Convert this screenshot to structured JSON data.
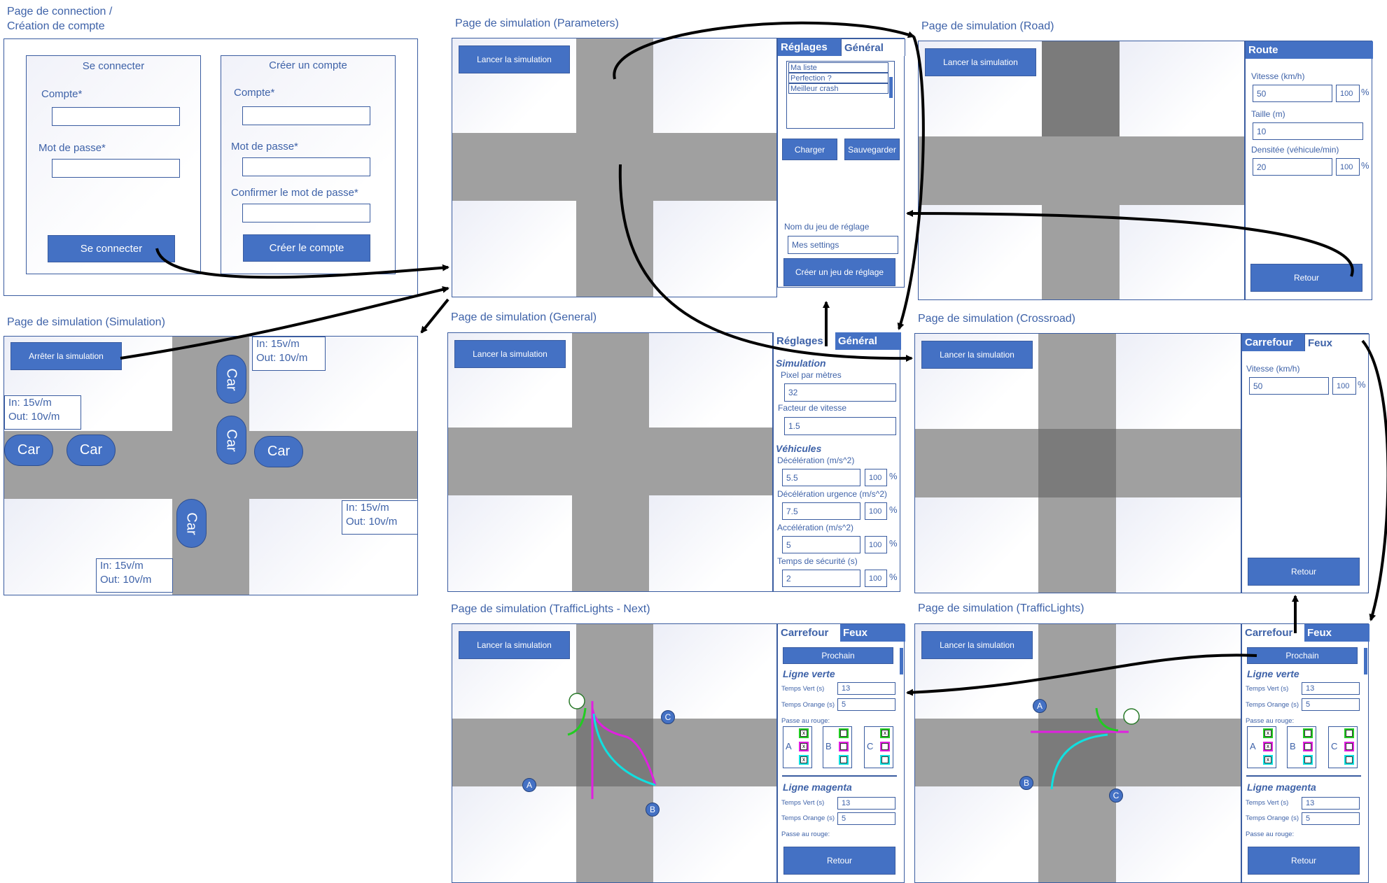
{
  "login": {
    "title_line1": "Page de connection /",
    "title_line2": "Création de compte",
    "connect_title": "Se connecter",
    "account_label": "Compte*",
    "password_label": "Mot de passe*",
    "connect_button": "Se connecter",
    "create_title": "Créer un compte",
    "create_account_label": "Compte*",
    "create_password_label": "Mot de passe*",
    "confirm_label": "Confirmer le mot de passe*",
    "create_button": "Créer le compte"
  },
  "parameters": {
    "title": "Page de simulation (Parameters)",
    "launch_button": "Lancer la simulation",
    "tab_reglages": "Réglages",
    "tab_general": "Général",
    "list_items": [
      "Ma liste",
      "Perfection ?",
      "Meilleur crash"
    ],
    "load_button": "Charger",
    "save_button": "Sauvegarder",
    "settings_name_label": "Nom du jeu de réglage",
    "settings_name_value": "Mes settings",
    "create_settings_button": "Créer un jeu de réglage"
  },
  "road": {
    "title": "Page de simulation (Road)",
    "launch_button": "Lancer la simulation",
    "header": "Route",
    "speed_label": "Vitesse (km/h)",
    "speed_value": "50",
    "speed_pct": "100",
    "size_label": "Taille (m)",
    "size_value": "10",
    "density_label": "Densitée (véhicule/min)",
    "density_value": "20",
    "density_pct": "100",
    "pct_sign": "%",
    "back_button": "Retour"
  },
  "simulation": {
    "title": "Page de simulation (Simulation)",
    "stop_button": "Arrêter la simulation",
    "car_label": "Car",
    "in_label": "In: 15v/m",
    "out_label": "Out: 10v/m"
  },
  "general": {
    "title": "Page de simulation (General)",
    "launch_button": "Lancer la simulation",
    "tab_reglages": "Réglages",
    "tab_general": "Général",
    "section_simulation": "Simulation",
    "pixel_label": "Pixel par mètres",
    "pixel_value": "32",
    "speed_factor_label": "Facteur de vitesse",
    "speed_factor_value": "1.5",
    "section_vehicles": "Véhicules",
    "decel_label": "Décélération (m/s^2)",
    "decel_value": "5.5",
    "decel_urg_label": "Décélération urgence (m/s^2)",
    "decel_urg_value": "7.5",
    "accel_label": "Accélération (m/s^2)",
    "accel_value": "5",
    "safety_label": "Temps de sécurité (s)",
    "safety_value": "2",
    "pct_value": "100",
    "pct_sign": "%"
  },
  "crossroad": {
    "title": "Page de simulation (Crossroad)",
    "launch_button": "Lancer la simulation",
    "tab_carrefour": "Carrefour",
    "tab_feux": "Feux",
    "speed_label": "Vitesse (km/h)",
    "speed_value": "50",
    "speed_pct": "100",
    "pct_sign": "%",
    "back_button": "Retour"
  },
  "tl_next": {
    "title": "Page de simulation (TrafficLights - Next)",
    "launch_button": "Lancer la simulation",
    "tab_carrefour": "Carrefour",
    "tab_feux": "Feux",
    "next_button": "Prochain",
    "green_line": "Ligne verte",
    "green_time_label": "Temps Vert (s)",
    "green_time_value": "13",
    "orange_time_label": "Temps Orange (s)",
    "orange_time_value": "5",
    "red_label": "Passe au rouge:",
    "magenta_line": "Ligne magenta",
    "magenta_green_value": "13",
    "magenta_orange_value": "5",
    "magenta_red_label": "Passe au rouge:",
    "back_button": "Retour",
    "letter_a": "A",
    "letter_b": "B",
    "letter_c": "C"
  },
  "tl": {
    "title": "Page de simulation (TrafficLights)",
    "launch_button": "Lancer la simulation",
    "tab_carrefour": "Carrefour",
    "tab_feux": "Feux",
    "next_button": "Prochain",
    "green_line": "Ligne verte",
    "green_time_label": "Temps Vert (s)",
    "green_time_value": "13",
    "orange_time_label": "Temps Orange (s)",
    "orange_time_value": "5",
    "red_label": "Passe au rouge:",
    "magenta_line": "Ligne magenta",
    "magenta_green_value": "13",
    "magenta_orange_value": "5",
    "magenta_red_label": "Passe au rouge:",
    "back_button": "Retour",
    "letter_a": "A",
    "letter_b": "B",
    "letter_c": "C"
  },
  "check_marks": {
    "checked": "x"
  },
  "colors": {
    "primary": "#4471c4",
    "text": "#3e62a8",
    "road": "#a0a0a0",
    "center": "#7b7b7b",
    "green": "#22cc22",
    "magenta": "#e020e0",
    "cyan": "#10e0e0"
  }
}
